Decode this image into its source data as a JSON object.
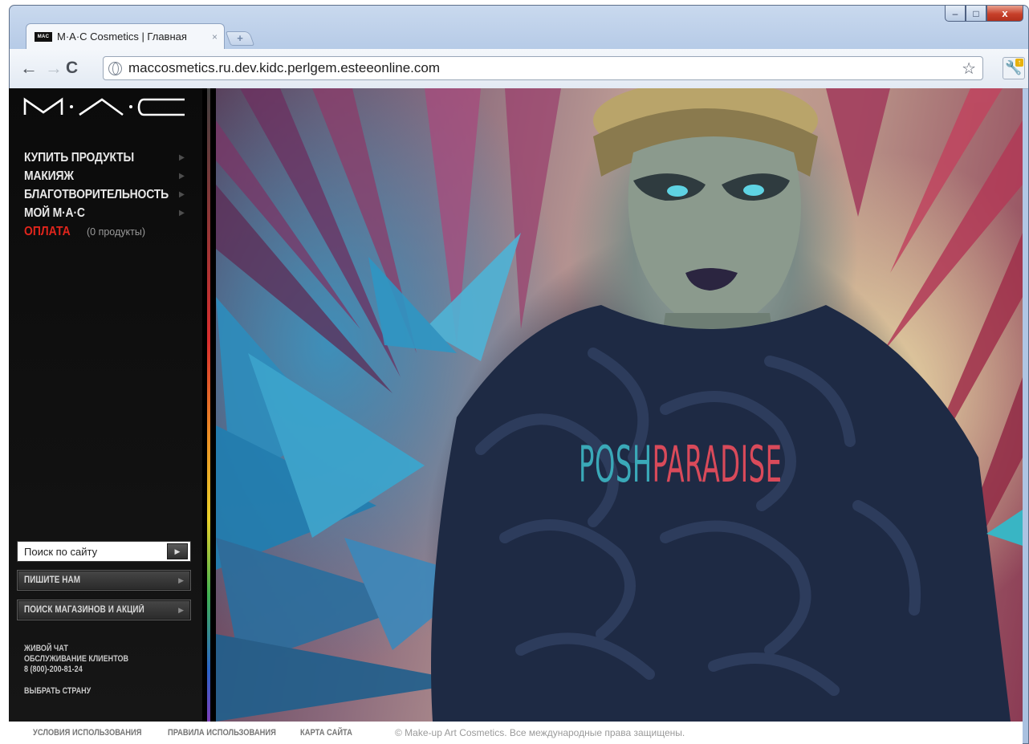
{
  "browser": {
    "tab_title": "M·A·C Cosmetics | Главная",
    "tab_close": "×",
    "new_tab": "+",
    "url": "maccosmetics.ru.dev.kidc.perlgem.esteeonline.com",
    "favicon_text": "MAC",
    "window_controls": {
      "minimize": "–",
      "maximize": "□",
      "close": "x"
    }
  },
  "icons": {
    "back": "←",
    "forward": "→",
    "reload": "C",
    "star": "☆",
    "wrench": "🔧",
    "menu_arrow": "▶",
    "button_arrow": "▶"
  },
  "sidebar": {
    "menu": [
      {
        "label": "КУПИТЬ ПРОДУКТЫ"
      },
      {
        "label": "МАКИЯЖ"
      },
      {
        "label": "БЛАГОТВОРИТЕЛЬНОСТЬ"
      },
      {
        "label": "МОЙ M·A·C"
      }
    ],
    "checkout_label": "ОПЛАТА",
    "checkout_count": "(0 продукты)",
    "search_placeholder": "Поиск по сайту",
    "write_us": "ПИШИТЕ НАМ",
    "store_search": "ПОИСК МАГАЗИНОВ И АКЦИЙ",
    "live_chat": "ЖИВОЙ ЧАТ",
    "customer_service": "ОБСЛУЖИВАНИЕ КЛИЕНТОВ",
    "phone": "8 (800)-200-81-24",
    "choose_country": "ВЫБРАТЬ СТРАНУ"
  },
  "hero": {
    "title_part1": "POSH",
    "title_part2": "PARADISE"
  },
  "footer": {
    "terms": "УСЛОВИЯ ИСПОЛЬЗОВАНИЯ",
    "rules": "ПРАВИЛА ИСПОЛЬЗОВАНИЯ",
    "sitemap": "КАРТА САЙТА",
    "copyright": "© Make-up Art Cosmetics. Все международные права защищены."
  },
  "colors": {
    "accent_red": "#e0251c",
    "title_teal": "#3aa9b8",
    "title_pink": "#d94a5a"
  }
}
